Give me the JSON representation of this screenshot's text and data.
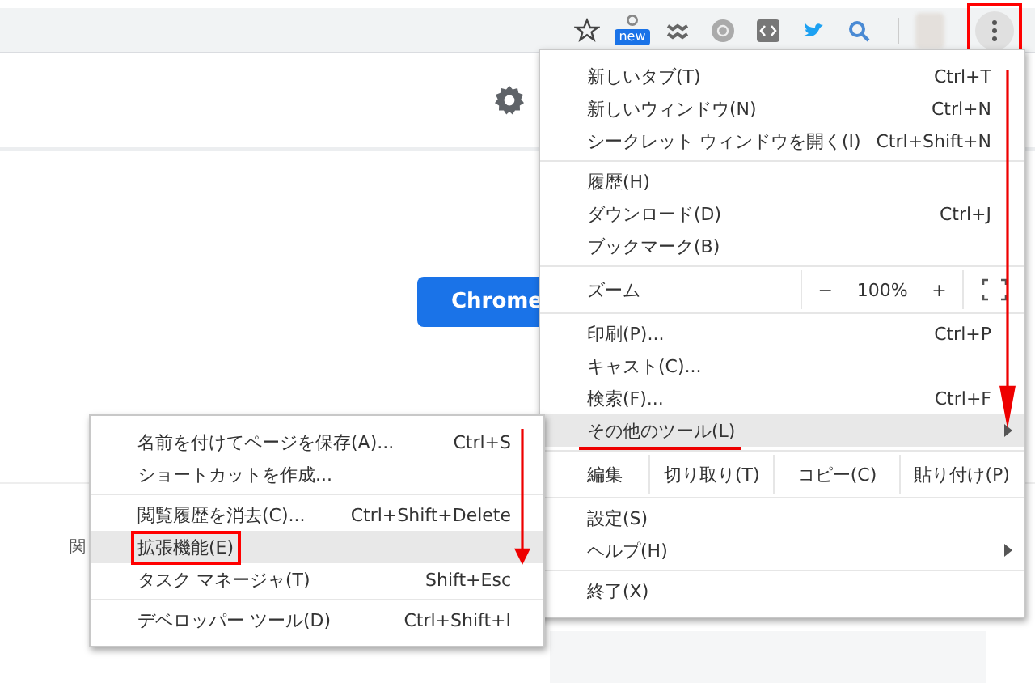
{
  "toolbar": {
    "extension_badge": "new",
    "menu_button": {
      "highlighted": true
    }
  },
  "page": {
    "button": "Chrome",
    "side_text": "関"
  },
  "main_menu": {
    "arrow": true,
    "sections": [
      [
        {
          "kind": "item",
          "label": "新しいタブ(T)",
          "shortcut": "Ctrl+T",
          "has_submenu": false,
          "selected": false,
          "underlined": false,
          "boxed": false
        },
        {
          "kind": "item",
          "label": "新しいウィンドウ(N)",
          "shortcut": "Ctrl+N",
          "has_submenu": false,
          "selected": false,
          "underlined": false,
          "boxed": false
        },
        {
          "kind": "item",
          "label": "シークレット ウィンドウを開く(I)",
          "shortcut": "Ctrl+Shift+N",
          "has_submenu": false,
          "selected": false,
          "underlined": false,
          "boxed": false
        }
      ],
      [
        {
          "kind": "item",
          "label": "履歴(H)",
          "has_submenu": false,
          "selected": false,
          "underlined": false,
          "boxed": false
        },
        {
          "kind": "item",
          "label": "ダウンロード(D)",
          "shortcut": "Ctrl+J",
          "has_submenu": false,
          "selected": false,
          "underlined": false,
          "boxed": false
        },
        {
          "kind": "item",
          "label": "ブックマーク(B)",
          "has_submenu": false,
          "selected": false,
          "underlined": false,
          "boxed": false
        }
      ],
      [
        {
          "kind": "zoom",
          "label": "ズーム",
          "minus": "−",
          "value": "100%",
          "plus": "+"
        }
      ],
      [
        {
          "kind": "item",
          "label": "印刷(P)...",
          "shortcut": "Ctrl+P",
          "has_submenu": false,
          "selected": false,
          "underlined": false,
          "boxed": false
        },
        {
          "kind": "item",
          "label": "キャスト(C)...",
          "has_submenu": false,
          "selected": false,
          "underlined": false,
          "boxed": false
        },
        {
          "kind": "item",
          "label": "検索(F)...",
          "shortcut": "Ctrl+F",
          "has_submenu": false,
          "selected": false,
          "underlined": false,
          "boxed": false
        },
        {
          "kind": "item",
          "label": "その他のツール(L)",
          "has_submenu": true,
          "selected": true,
          "underlined": true,
          "boxed": false
        }
      ],
      [
        {
          "kind": "edit",
          "label": "編集",
          "buttons": [
            "切り取り(T)",
            "コピー(C)",
            "貼り付け(P)"
          ]
        }
      ],
      [
        {
          "kind": "item",
          "label": "設定(S)",
          "has_submenu": false,
          "selected": false,
          "underlined": false,
          "boxed": false
        },
        {
          "kind": "item",
          "label": "ヘルプ(H)",
          "has_submenu": true,
          "selected": false,
          "underlined": false,
          "boxed": false
        }
      ],
      [
        {
          "kind": "item",
          "label": "終了(X)",
          "has_submenu": false,
          "selected": false,
          "underlined": false,
          "boxed": false
        }
      ]
    ]
  },
  "sub_menu": {
    "arrow": true,
    "sections": [
      [
        {
          "kind": "item",
          "label": "名前を付けてページを保存(A)...",
          "shortcut": "Ctrl+S",
          "has_submenu": false,
          "selected": false,
          "underlined": false,
          "boxed": false
        },
        {
          "kind": "item",
          "label": "ショートカットを作成...",
          "has_submenu": false,
          "selected": false,
          "underlined": false,
          "boxed": false
        }
      ],
      [
        {
          "kind": "item",
          "label": "閲覧履歴を消去(C)...",
          "shortcut": "Ctrl+Shift+Delete",
          "has_submenu": false,
          "selected": false,
          "underlined": false,
          "boxed": false
        },
        {
          "kind": "item",
          "label": "拡張機能(E)",
          "has_submenu": false,
          "selected": true,
          "underlined": false,
          "boxed": true
        },
        {
          "kind": "item",
          "label": "タスク マネージャ(T)",
          "shortcut": "Shift+Esc",
          "has_submenu": false,
          "selected": false,
          "underlined": false,
          "boxed": false
        }
      ],
      [
        {
          "kind": "item",
          "label": "デベロッパー ツール(D)",
          "shortcut": "Ctrl+Shift+I",
          "has_submenu": false,
          "selected": false,
          "underlined": false,
          "boxed": false
        }
      ]
    ]
  }
}
